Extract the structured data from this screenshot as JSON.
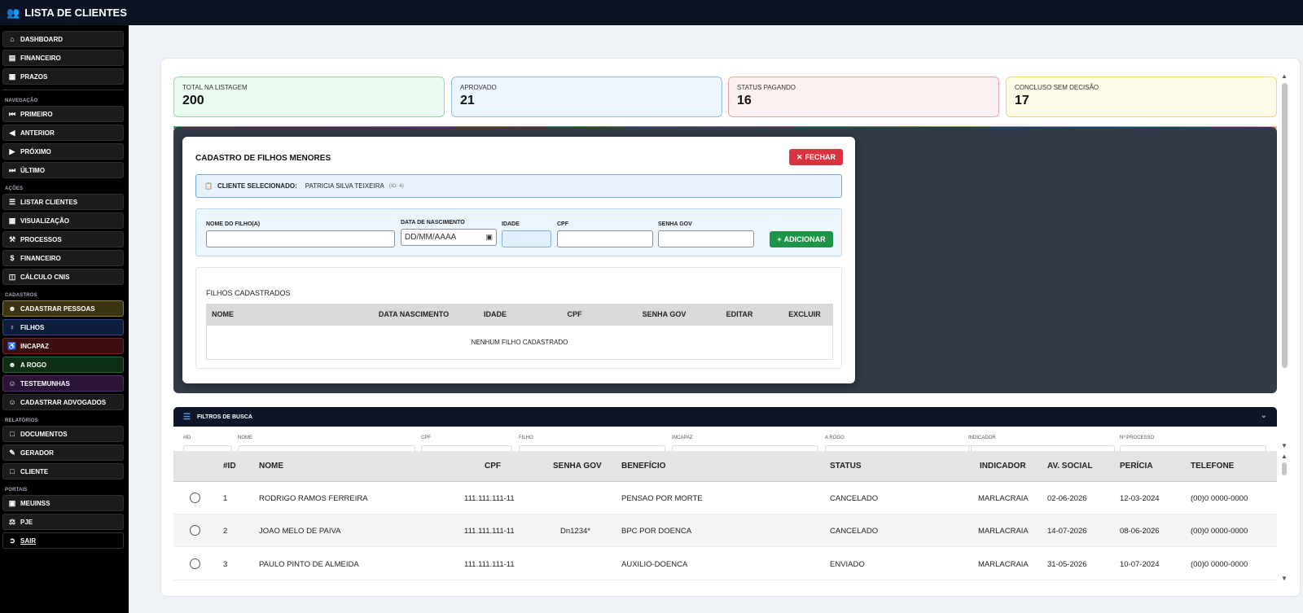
{
  "app": {
    "title": "LISTA DE CLIENTES",
    "icon": "users-icon"
  },
  "sidebar": {
    "top": [
      {
        "label": "DASHBOARD",
        "icon": "home-icon"
      },
      {
        "label": "FINANCEIRO",
        "icon": "wallet-icon"
      },
      {
        "label": "PRAZOS",
        "icon": "calendar-icon"
      }
    ],
    "nav_title": "NAVEGAÇÃO",
    "nav": [
      {
        "label": "PRIMEIRO",
        "icon": "first-icon"
      },
      {
        "label": "ANTERIOR",
        "icon": "prev-icon"
      },
      {
        "label": "PRÓXIMO",
        "icon": "next-icon"
      },
      {
        "label": "ÚLTIMO",
        "icon": "last-icon"
      }
    ],
    "acoes_title": "AÇÕES",
    "acoes": [
      {
        "label": "LISTAR CLIENTES",
        "icon": "list-icon"
      },
      {
        "label": "VISUALIZAÇÃO",
        "icon": "grid-icon"
      },
      {
        "label": "PROCESSOS",
        "icon": "wrench-icon"
      },
      {
        "label": "FINANCEIRO",
        "icon": "dollar-icon"
      },
      {
        "label": "CÁLCULO CNIS",
        "icon": "calculator-icon"
      }
    ],
    "cadastros_title": "CADASTROS",
    "cadastros": [
      {
        "label": "CADASTRAR PESSOAS",
        "icon": "user-plus-icon",
        "bg": "#3b3410",
        "border": "#8a7a25"
      },
      {
        "label": "FILHOS",
        "icon": "child-icon",
        "bg": "#0f1d3d",
        "border": "#2a4a8a"
      },
      {
        "label": "INCAPAZ",
        "icon": "wheelchair-icon",
        "bg": "#3a0e0e",
        "border": "#7a2222"
      },
      {
        "label": "A ROGO",
        "icon": "user-check-icon",
        "bg": "#0e2e14",
        "border": "#2a6a34"
      },
      {
        "label": "TESTEMUNHAS",
        "icon": "users-icon",
        "bg": "#2a1238",
        "border": "#5a2a7a"
      },
      {
        "label": "CADASTRAR ADVOGADOS",
        "icon": "user-icon",
        "bg": "#1b1b1b",
        "border": "#2e2e2e"
      }
    ],
    "relatorios_title": "RELATÓRIOS",
    "relatorios": [
      {
        "label": "DOCUMENTOS",
        "icon": "file-icon"
      },
      {
        "label": "GERADOR",
        "icon": "file-edit-icon"
      },
      {
        "label": "CLIENTE",
        "icon": "file-user-icon"
      }
    ],
    "portais_title": "PORTAIS",
    "portais": [
      {
        "label": "MEUINSS",
        "icon": "id-card-icon"
      },
      {
        "label": "PJE",
        "icon": "scale-icon"
      }
    ],
    "sair": "SAIR"
  },
  "stats": [
    {
      "label": "TOTAL NA LISTAGEM",
      "value": "200",
      "bg": "#ecfbf1",
      "border": "#8fd9a8"
    },
    {
      "label": "APROVADO",
      "value": "21",
      "bg": "#ecf4fe",
      "border": "#93bde9"
    },
    {
      "label": "STATUS PAGANDO",
      "value": "16",
      "bg": "#fdf0f0",
      "border": "#eba3a3"
    },
    {
      "label": "CONCLUSO SEM DECISÃO",
      "value": "17",
      "bg": "#fdfbe6",
      "border": "#e6d87a"
    }
  ],
  "modal": {
    "title": "CADASTRO DE FILHOS MENORES",
    "close_label": "FECHAR",
    "client_label": "CLIENTE SELECIONADO:",
    "client_name": "PATRICIA SILVA TEIXEIRA",
    "client_id": "(ID: 4)",
    "form": {
      "nome_label": "NOME DO FILHO(A)",
      "nasc_label": "DATA DE NASCIMENTO",
      "nasc_placeholder": "DD/MM/AAAA",
      "idade_label": "IDADE",
      "cpf_label": "CPF",
      "senha_label": "SENHA GOV",
      "add_label": "ADICIONAR"
    },
    "list_title": "FILHOS CADASTRADOS",
    "columns": [
      "NOME",
      "DATA NASCIMENTO",
      "IDADE",
      "CPF",
      "SENHA GOV",
      "EDITAR",
      "EXCLUIR"
    ],
    "empty": "NENHUM FILHO CADASTRADO"
  },
  "filters": {
    "title": "FILTROS DE BUSCA",
    "fields": [
      "#ID",
      "NOME",
      "CPF",
      "FILHO",
      "INCAPAZ",
      "A ROGO",
      "INDICADOR",
      "Nº PROCESSO"
    ]
  },
  "table": {
    "columns": [
      "#ID",
      "NOME",
      "CPF",
      "SENHA GOV",
      "BENEFÍCIO",
      "STATUS",
      "INDICADOR",
      "AV. SOCIAL",
      "PERÍCIA",
      "TELEFONE"
    ],
    "rows": [
      {
        "id": "1",
        "nome": "RODRIGO RAMOS FERREIRA",
        "cpf": "111.111.111-11",
        "senha": "",
        "beneficio": "PENSAO POR MORTE",
        "status": "CANCELADO",
        "indicador": "MARLACRAIA",
        "av_social": "02-06-2026",
        "pericia": "12-03-2024",
        "telefone": "(00)0 0000-0000"
      },
      {
        "id": "2",
        "nome": "JOAO MELO DE PAIVA",
        "cpf": "111.111.111-11",
        "senha": "Dn1234*",
        "beneficio": "BPC POR DOENCA",
        "status": "CANCELADO",
        "indicador": "MARLACRAIA",
        "av_social": "14-07-2026",
        "pericia": "08-06-2026",
        "telefone": "(00)0 0000-0000"
      },
      {
        "id": "3",
        "nome": "PAULO PINTO DE ALMEIDA",
        "cpf": "111.111.111-11",
        "senha": "",
        "beneficio": "AUXILIO-DOENCA",
        "status": "ENVIADO",
        "indicador": "MARLACRAIA",
        "av_social": "31-05-2026",
        "pericia": "10-07-2024",
        "telefone": "(00)0 0000-0000"
      }
    ]
  }
}
